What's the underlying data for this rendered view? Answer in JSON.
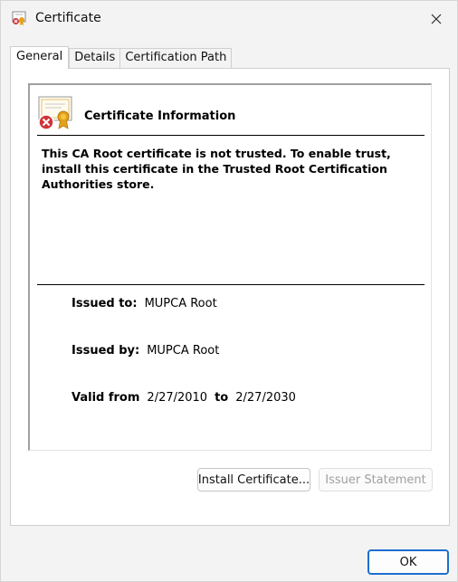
{
  "window": {
    "title": "Certificate",
    "close_icon": "close-icon"
  },
  "tabs": [
    {
      "label": "General",
      "active": true
    },
    {
      "label": "Details",
      "active": false
    },
    {
      "label": "Certification Path",
      "active": false
    }
  ],
  "general": {
    "icon": "certificate-untrusted-icon",
    "heading": "Certificate Information",
    "warning": "This CA Root certificate is not trusted. To enable trust, install this certificate in the Trusted Root Certification Authorities store.",
    "issued_to_label": "Issued to:",
    "issued_to_value": "MUPCA Root",
    "issued_by_label": "Issued by:",
    "issued_by_value": "MUPCA Root",
    "valid_from_label": "Valid from",
    "valid_from_value": "2/27/2010",
    "valid_to_label": "to",
    "valid_to_value": "2/27/2030",
    "install_button": "Install Certificate...",
    "issuer_statement_button": "Issuer Statement"
  },
  "footer": {
    "ok_button": "OK"
  },
  "colors": {
    "accent": "#1e6fd0",
    "error_red": "#d13438",
    "seal_gold": "#e3a21a"
  }
}
